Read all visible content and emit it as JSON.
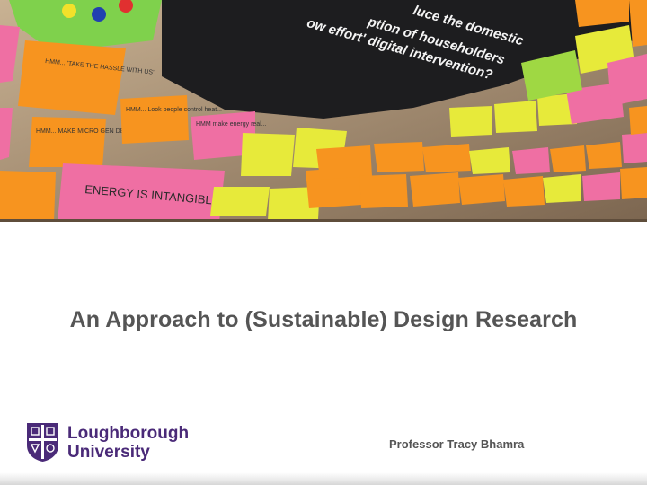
{
  "slide": {
    "title": "An Approach to (Sustainable) Design Research",
    "presenter": "Professor Tracy Bhamra"
  },
  "photo": {
    "description_icon": "sticky-notes-wall-photo",
    "slogan_lines": [
      "luce the domestic",
      "ption of householders",
      "ow effort' digital intervention?"
    ],
    "notes": [
      "HMM... 'TAKE THE HASSLE WITH US'",
      "HMM... MAKE MICRO GEN DESIRABLE?",
      "ENERGY IS INTANGIBLE!",
      "HMM... Look people control heat...",
      "HMM make energy real..."
    ]
  },
  "logo": {
    "line1": "Loughborough",
    "line2": "University",
    "color": "#4a2a78"
  },
  "colors": {
    "title": "#555555",
    "brand_purple": "#4a2a78"
  }
}
